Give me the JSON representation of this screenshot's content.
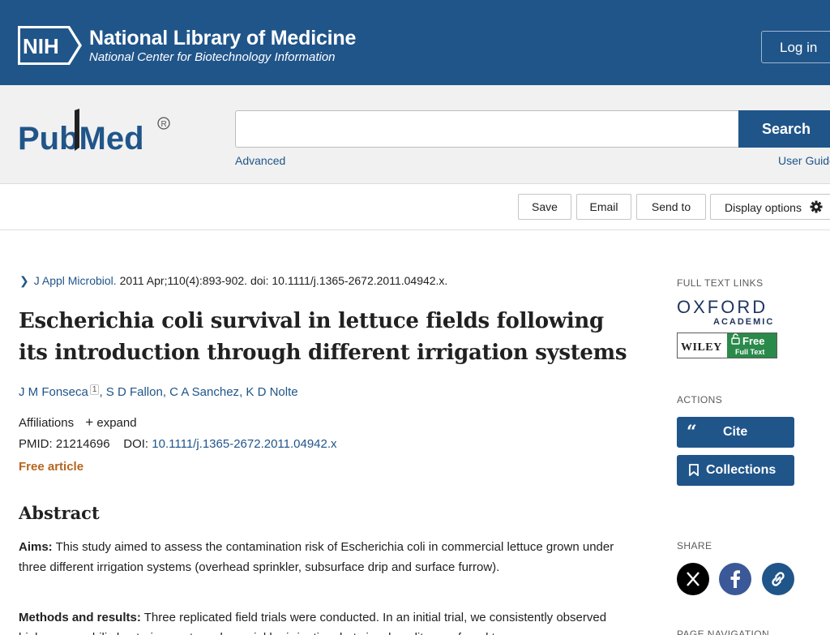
{
  "nih": {
    "logo_text": "NIH",
    "title": "National Library of Medicine",
    "subtitle": "National Center for Biotechnology Information",
    "login_label": "Log in"
  },
  "search": {
    "logo_text": "PubMed",
    "value": "",
    "button_label": "Search",
    "advanced_label": "Advanced",
    "user_guide_label": "User Guide"
  },
  "toolbar": {
    "save_label": "Save",
    "email_label": "Email",
    "send_to_label": "Send to",
    "display_options_label": "Display options"
  },
  "article": {
    "journal": "J Appl Microbiol.",
    "citation": "2011 Apr;110(4):893-902. doi: 10.1111/j.1365-2672.2011.04942.x.",
    "title": "Escherichia coli survival in lettuce fields following its introduction through different irrigation systems",
    "authors": [
      {
        "name": "J M Fonseca",
        "sup": "1"
      },
      {
        "name": "S D Fallon"
      },
      {
        "name": "C A Sanchez"
      },
      {
        "name": "K D Nolte"
      }
    ],
    "affiliations_label": "Affiliations",
    "expand_label": "expand",
    "pmid_label": "PMID:",
    "pmid": "21214696",
    "doi_label": "DOI:",
    "doi": "10.1111/j.1365-2672.2011.04942.x",
    "free_label": "Free article"
  },
  "abstract": {
    "heading": "Abstract",
    "aims_label": "Aims:",
    "aims_text": "This study aimed to assess the contamination risk of Escherichia coli in commercial lettuce grown under three different irrigation systems (overhead sprinkler, subsurface drip and surface furrow).",
    "methods_label": "Methods and results:",
    "methods_text": "Three replicated field trials were conducted. In an initial trial, we consistently observed higher mesophilic bacteria counts under sprinkler irrigation, but visual quality was found to"
  },
  "sidebar": {
    "full_text_label": "FULL TEXT LINKS",
    "oxford_top": "OXFORD",
    "oxford_bottom": "ACADEMIC",
    "wiley_text": "WILEY",
    "wiley_free": "Free",
    "wiley_full_text": "Full Text",
    "actions_label": "ACTIONS",
    "cite_label": "Cite",
    "collections_label": "Collections",
    "share_label": "SHARE",
    "page_nav_label": "PAGE NAVIGATION"
  },
  "colors": {
    "brand_blue": "#20558a",
    "free_orange": "#b5651d",
    "wiley_green": "#2a8a4a"
  }
}
